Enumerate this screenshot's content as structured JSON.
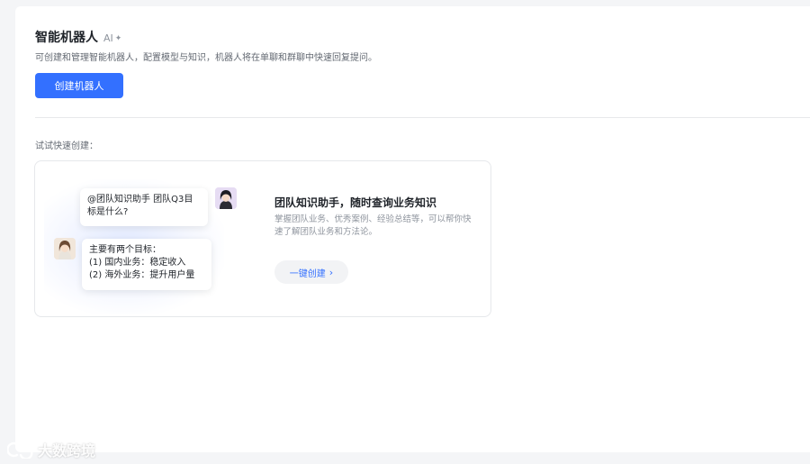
{
  "header": {
    "title": "智能机器人",
    "badge": "AI",
    "badge_icon": "sparkle-plus-icon",
    "subtitle": "可创建和管理智能机器人，配置模型与知识，机器人将在单聊和群聊中快速回复提问。",
    "create_button_label": "创建机器人"
  },
  "quick_create": {
    "section_label": "试试快速创建：",
    "templates": [
      {
        "question": "@团队知识助手 团队Q3目标是什么?",
        "answer_lines": [
          "主要有两个目标：",
          "(1) 国内业务：稳定收入",
          "(2) 海外业务：提升用户量"
        ],
        "title": "团队知识助手，随时查询业务知识",
        "description": "掌握团队业务、优秀案例、经验总结等，可以帮你快速了解团队业务和方法论。",
        "button_label": "一键创建"
      }
    ]
  },
  "watermark": {
    "text": "大数跨境"
  },
  "colors": {
    "primary": "#3370ff",
    "text_primary": "#1f2329",
    "text_secondary": "#646a73"
  }
}
